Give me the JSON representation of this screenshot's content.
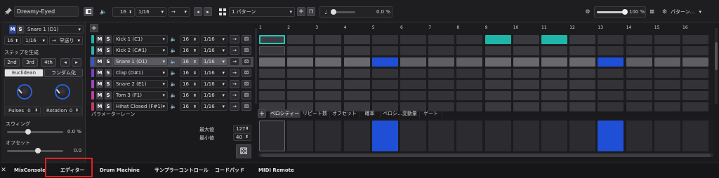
{
  "top": {
    "pattern_name": "Dreamy-Eyed",
    "step_count": "16",
    "resolution": "1/16",
    "pattern_select": "1 パターン",
    "swing_percent": "0.0 %",
    "velocity_percent": "100 %",
    "pattern_menu": "パターン..."
  },
  "left_panel": {
    "selected_pad": "Snare 1 (D1)",
    "steps": "16",
    "resolution": "1/16",
    "direction": "早送り",
    "step_gen_label": "ステップを生成",
    "quick_btns": [
      "2nd",
      "3rd",
      "4th"
    ],
    "euclidean": "Euclidean",
    "randomize": "ランダム化",
    "pulses": "Pulses",
    "pulses_value": "0",
    "rotation": "Rotation",
    "rotation_value": "0",
    "swing_label": "スウィング",
    "swing_value": "0.0 %",
    "offset_label": "オフセット",
    "offset_value": "0.0"
  },
  "ms": {
    "m": "M",
    "s": "S"
  },
  "tracks": [
    {
      "name": "Kick 1 (C1)",
      "steps": "16",
      "res": "1/16",
      "color": "#1fb5a8"
    },
    {
      "name": "Kick 2 (C#1)",
      "steps": "16",
      "res": "1/16",
      "color": "#2bb0b5"
    },
    {
      "name": "Snare 1 (D1)",
      "steps": "16",
      "res": "1/16",
      "color": "#2d58d8"
    },
    {
      "name": "Clap (D#1)",
      "steps": "16",
      "res": "1/16",
      "color": "#7a3fc8"
    },
    {
      "name": "Snare 2 (E1)",
      "steps": "16",
      "res": "1/16",
      "color": "#a245c0"
    },
    {
      "name": "Tom 3 (F1)",
      "steps": "16",
      "res": "1/16",
      "color": "#c03da0"
    },
    {
      "name": "Hihat Closed (F#1)",
      "steps": "16",
      "res": "1/16",
      "color": "#c03a6a"
    }
  ],
  "grid": {
    "step_numbers": [
      "1",
      "2",
      "3",
      "4",
      "5",
      "6",
      "7",
      "8",
      "9",
      "10",
      "11",
      "12",
      "13",
      "14",
      "15",
      "16"
    ],
    "active": [
      {
        "row": 0,
        "steps": [
          9,
          11
        ],
        "color": "#1fb5a8"
      },
      {
        "row": 2,
        "steps": [
          5,
          13
        ],
        "color": "#1f4fd6"
      }
    ],
    "cursor_step": 1
  },
  "param_lane": {
    "title": "パラメーターレーン",
    "max_label": "最大値",
    "max_value": "127",
    "min_label": "最小値",
    "min_value": "40",
    "tabs": [
      "ベロシティー",
      "リピート数",
      "オフセット",
      "確率",
      "ベロシ...変動量",
      "ゲート"
    ],
    "active_tab": 0,
    "velocity_bars": [
      5,
      13
    ]
  },
  "bottom_tabs": [
    "MixConsole",
    "エディター",
    "Drum Machine",
    "サンプラーコントロール",
    "コードパッド",
    "MIDI Remote"
  ],
  "active_bottom_tab": 1
}
